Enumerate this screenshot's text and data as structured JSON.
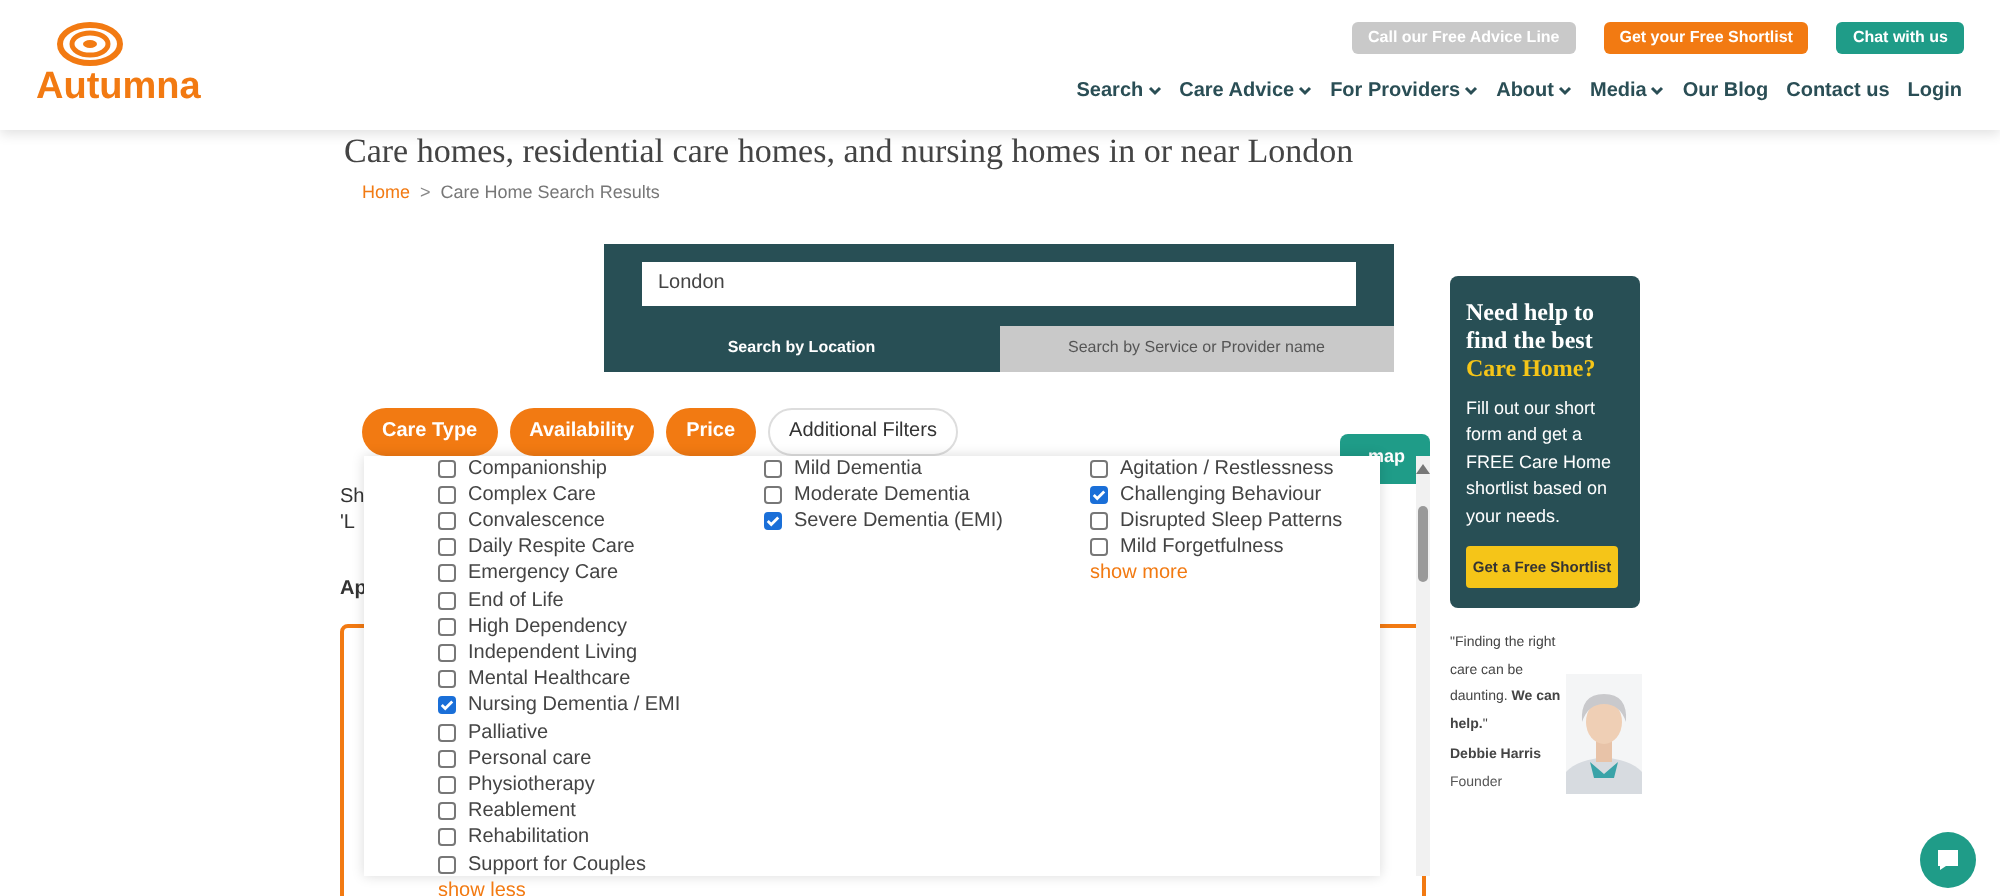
{
  "header": {
    "logo": "Autumna",
    "top_buttons": [
      {
        "label": "Call our Free Advice Line",
        "kind": "grey"
      },
      {
        "label": "Get your Free Shortlist",
        "kind": "orange"
      },
      {
        "label": "Chat with us",
        "kind": "teal"
      }
    ],
    "nav": [
      {
        "label": "Search",
        "dropdown": true
      },
      {
        "label": "Care Advice",
        "dropdown": true
      },
      {
        "label": "For Providers",
        "dropdown": true
      },
      {
        "label": "About",
        "dropdown": true
      },
      {
        "label": "Media",
        "dropdown": true
      },
      {
        "label": "Our Blog",
        "dropdown": false
      },
      {
        "label": "Contact us",
        "dropdown": false
      },
      {
        "label": "Login",
        "dropdown": false
      }
    ]
  },
  "heading": "Care homes, residential care homes, and nursing homes in or near London",
  "breadcrumb": [
    {
      "label": "Home",
      "link": true
    },
    {
      "label": "Care Home Search Results",
      "link": false
    }
  ],
  "breadcrumb_separator": ">",
  "search": {
    "value": "London",
    "tabs": [
      {
        "label": "Search by Location",
        "selected": true
      },
      {
        "label": "Search by Service or Provider name",
        "selected": false
      }
    ]
  },
  "filters": [
    {
      "label": "Care Type",
      "selected": true
    },
    {
      "label": "Availability",
      "selected": true
    },
    {
      "label": "Price",
      "selected": true
    },
    {
      "label": "Additional Filters",
      "selected": false
    }
  ],
  "behind": {
    "lines": [
      "Sh",
      "'L"
    ],
    "apply": "Ap",
    "map_button": "map"
  },
  "dropdown": {
    "columns": [
      {
        "items": [
          {
            "label": "Companionship",
            "checked": false
          },
          {
            "label": "Complex Care",
            "checked": false
          },
          {
            "label": "Convalescence",
            "checked": false
          },
          {
            "label": "Daily Respite Care",
            "checked": false
          },
          {
            "label": "Emergency Care",
            "checked": false
          },
          {
            "label": "End of Life",
            "checked": false
          },
          {
            "label": "High Dependency",
            "checked": false
          },
          {
            "label": "Independent Living",
            "checked": false
          },
          {
            "label": "Mental Healthcare",
            "checked": false
          },
          {
            "label": "Nursing Dementia / EMI",
            "checked": true
          },
          {
            "label": "Palliative",
            "checked": false
          },
          {
            "label": "Personal care",
            "checked": false
          },
          {
            "label": "Physiotherapy",
            "checked": false
          },
          {
            "label": "Reablement",
            "checked": false
          },
          {
            "label": "Rehabilitation",
            "checked": false
          },
          {
            "label": "Support for Couples",
            "checked": false
          }
        ],
        "toggle": "show less"
      },
      {
        "items": [
          {
            "label": "Mild Dementia",
            "checked": false
          },
          {
            "label": "Moderate Dementia",
            "checked": false
          },
          {
            "label": "Severe Dementia (EMI)",
            "checked": true
          }
        ]
      },
      {
        "items": [
          {
            "label": "Agitation / Restlessness",
            "checked": false
          },
          {
            "label": "Challenging Behaviour",
            "checked": true
          },
          {
            "label": "Disrupted Sleep Patterns",
            "checked": false
          },
          {
            "label": "Mild Forgetfulness",
            "checked": false
          }
        ],
        "toggle": "show more"
      }
    ]
  },
  "sidebar": {
    "title": "Need help to find the best",
    "title_highlight": "Care Home?",
    "text": "Fill out our short form and get a FREE Care Home shortlist based on your needs.",
    "button": "Get a Free Shortlist",
    "quote": "\"Finding the right care can be daunting. **We can help.**\"",
    "name": "Debbie Harris",
    "role": "Founder"
  }
}
